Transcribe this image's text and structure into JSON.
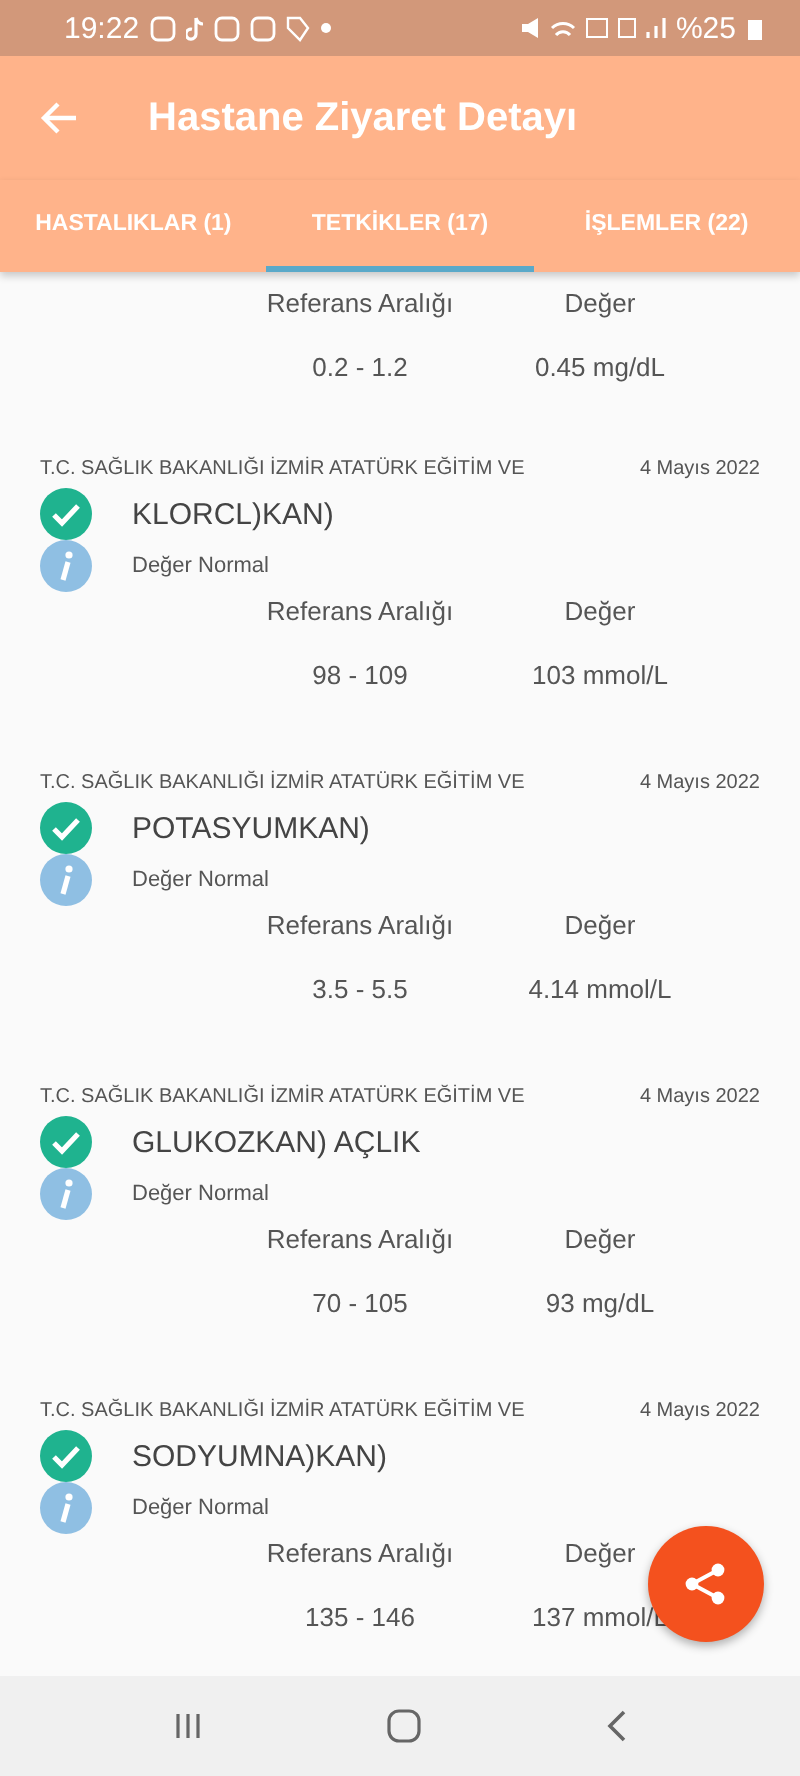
{
  "status_bar": {
    "time": "19:22",
    "battery": "%25"
  },
  "app_bar": {
    "title": "Hastane Ziyaret Detayı"
  },
  "tabs": [
    {
      "label": "HASTALIKLAR (1)",
      "selected": false
    },
    {
      "label": "TETKİKLER (17)",
      "selected": true
    },
    {
      "label": "İŞLEMLER (22)",
      "selected": false
    }
  ],
  "partial_result": {
    "range_label": "Referans Aralığı",
    "value_label": "Değer",
    "range": "0.2 - 1.2",
    "value": "0.45 mg/dL"
  },
  "results": [
    {
      "institution": "T.C. SAĞLIK BAKANLIĞI İZMİR ATATÜRK EĞİTİM VE",
      "date": "4 Mayıs 2022",
      "test": "KLORCL)KAN)",
      "status": "Değer Normal",
      "normal": true,
      "range_label": "Referans Aralığı",
      "value_label": "Değer",
      "range": "98 - 109",
      "value": "103 mmol/L"
    },
    {
      "institution": "T.C. SAĞLIK BAKANLIĞI İZMİR ATATÜRK EĞİTİM VE",
      "date": "4 Mayıs 2022",
      "test": "POTASYUMKAN)",
      "status": "Değer Normal",
      "normal": true,
      "range_label": "Referans Aralığı",
      "value_label": "Değer",
      "range": "3.5 - 5.5",
      "value": "4.14 mmol/L"
    },
    {
      "institution": "T.C. SAĞLIK BAKANLIĞI İZMİR ATATÜRK EĞİTİM VE",
      "date": "4 Mayıs 2022",
      "test": "GLUKOZKAN) AÇLIK",
      "status": "Değer Normal",
      "normal": true,
      "range_label": "Referans Aralığı",
      "value_label": "Değer",
      "range": "70 - 105",
      "value": "93 mg/dL"
    },
    {
      "institution": "T.C. SAĞLIK BAKANLIĞI İZMİR ATATÜRK EĞİTİM VE",
      "date": "4 Mayıs 2022",
      "test": "SODYUMNA)KAN)",
      "status": "Değer Normal",
      "normal": true,
      "range_label": "Referans Aralığı",
      "value_label": "Değer",
      "range": "135 - 146",
      "value": "137 mmol/L"
    }
  ]
}
